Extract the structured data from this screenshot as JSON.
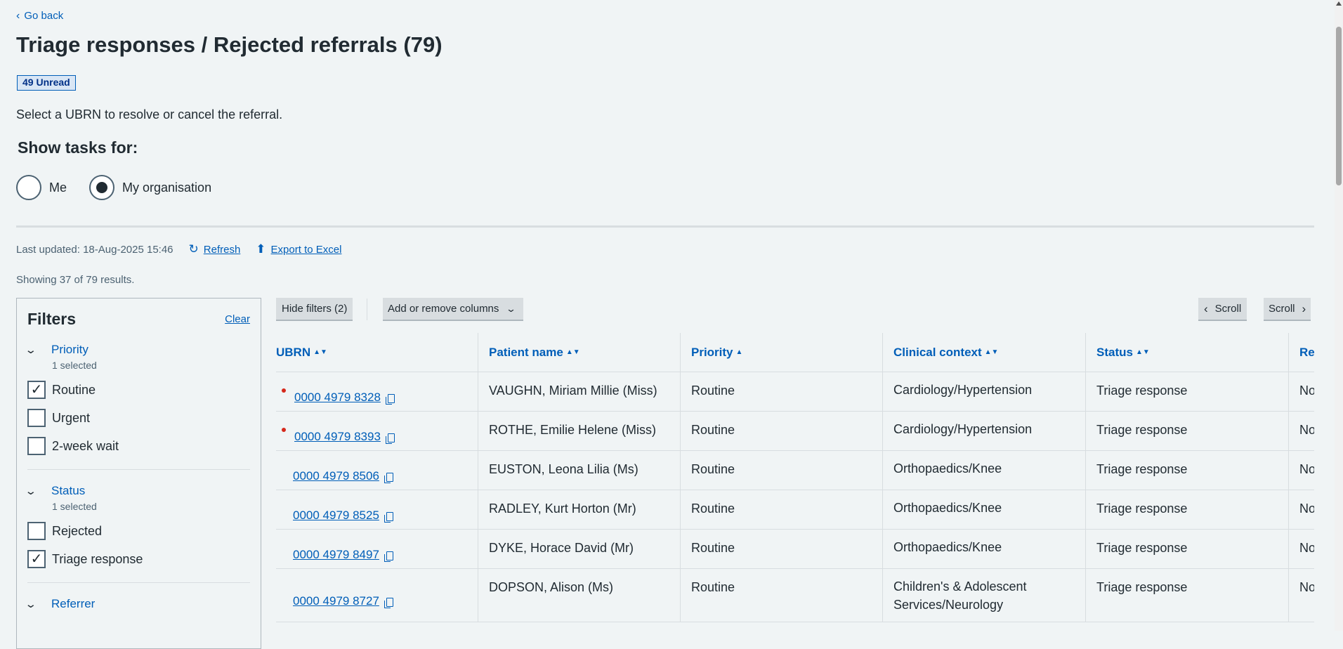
{
  "nav": {
    "go_back": "Go back"
  },
  "header": {
    "title": "Triage responses / Rejected referrals (79)",
    "unread_badge": "49 Unread",
    "intro": "Select a UBRN to resolve or cancel the referral."
  },
  "show_tasks": {
    "label": "Show tasks for:",
    "options": [
      {
        "label": "Me",
        "checked": false
      },
      {
        "label": "My organisation",
        "checked": true
      }
    ]
  },
  "meta": {
    "last_updated": "Last updated: 18-Aug-2025 15:46",
    "refresh": "Refresh",
    "export": "Export to Excel",
    "showing": "Showing 37 of 79 results."
  },
  "filters": {
    "title": "Filters",
    "clear": "Clear",
    "groups": [
      {
        "name": "Priority",
        "selected": "1 selected",
        "options": [
          {
            "label": "Routine",
            "checked": true
          },
          {
            "label": "Urgent",
            "checked": false
          },
          {
            "label": "2-week wait",
            "checked": false
          }
        ]
      },
      {
        "name": "Status",
        "selected": "1 selected",
        "options": [
          {
            "label": "Rejected",
            "checked": false
          },
          {
            "label": "Triage response",
            "checked": true
          }
        ]
      },
      {
        "name": "Referrer"
      }
    ]
  },
  "toolbar": {
    "hide_filters": "Hide filters (2)",
    "add_remove_columns": "Add or remove columns",
    "scroll_left": "Scroll",
    "scroll_right": "Scroll"
  },
  "table": {
    "columns": [
      "UBRN",
      "Patient name",
      "Priority",
      "Clinical context",
      "Status",
      "Rea"
    ],
    "rows": [
      {
        "unread": true,
        "ubrn": "0000 4979 8328",
        "patient": "VAUGHN, Miriam Millie (Miss)",
        "priority": "Routine",
        "context": "Cardiology/Hypertension",
        "status": "Triage response",
        "rea": "No"
      },
      {
        "unread": true,
        "ubrn": "0000 4979 8393",
        "patient": "ROTHE, Emilie Helene (Miss)",
        "priority": "Routine",
        "context": "Cardiology/Hypertension",
        "status": "Triage response",
        "rea": "No"
      },
      {
        "unread": false,
        "ubrn": "0000 4979 8506",
        "patient": "EUSTON, Leona Lilia (Ms)",
        "priority": "Routine",
        "context": "Orthopaedics/Knee",
        "status": "Triage response",
        "rea": "No"
      },
      {
        "unread": false,
        "ubrn": "0000 4979 8525",
        "patient": "RADLEY, Kurt Horton (Mr)",
        "priority": "Routine",
        "context": "Orthopaedics/Knee",
        "status": "Triage response",
        "rea": "No"
      },
      {
        "unread": false,
        "ubrn": "0000 4979 8497",
        "patient": "DYKE, Horace David (Mr)",
        "priority": "Routine",
        "context": "Orthopaedics/Knee",
        "status": "Triage response",
        "rea": "No"
      },
      {
        "unread": false,
        "ubrn": "0000 4979 8727",
        "patient": "DOPSON, Alison (Ms)",
        "priority": "Routine",
        "context": "Children's & Adolescent Services/Neurology",
        "status": "Triage response",
        "rea": "No"
      }
    ]
  }
}
